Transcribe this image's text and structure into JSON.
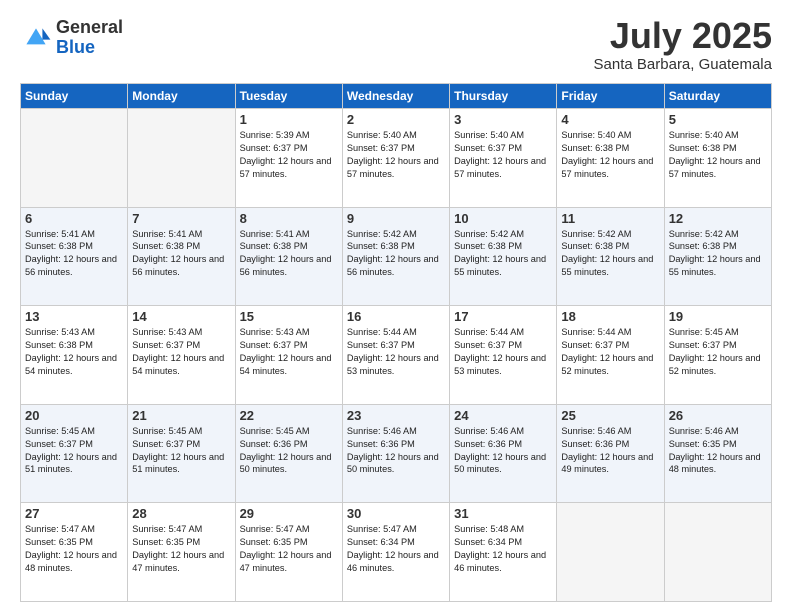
{
  "header": {
    "logo": {
      "general": "General",
      "blue": "Blue"
    },
    "title": "July 2025",
    "location": "Santa Barbara, Guatemala"
  },
  "days_of_week": [
    "Sunday",
    "Monday",
    "Tuesday",
    "Wednesday",
    "Thursday",
    "Friday",
    "Saturday"
  ],
  "weeks": [
    [
      {
        "day": "",
        "empty": true
      },
      {
        "day": "",
        "empty": true
      },
      {
        "day": "1",
        "sunrise": "Sunrise: 5:39 AM",
        "sunset": "Sunset: 6:37 PM",
        "daylight": "Daylight: 12 hours and 57 minutes."
      },
      {
        "day": "2",
        "sunrise": "Sunrise: 5:40 AM",
        "sunset": "Sunset: 6:37 PM",
        "daylight": "Daylight: 12 hours and 57 minutes."
      },
      {
        "day": "3",
        "sunrise": "Sunrise: 5:40 AM",
        "sunset": "Sunset: 6:37 PM",
        "daylight": "Daylight: 12 hours and 57 minutes."
      },
      {
        "day": "4",
        "sunrise": "Sunrise: 5:40 AM",
        "sunset": "Sunset: 6:38 PM",
        "daylight": "Daylight: 12 hours and 57 minutes."
      },
      {
        "day": "5",
        "sunrise": "Sunrise: 5:40 AM",
        "sunset": "Sunset: 6:38 PM",
        "daylight": "Daylight: 12 hours and 57 minutes."
      }
    ],
    [
      {
        "day": "6",
        "sunrise": "Sunrise: 5:41 AM",
        "sunset": "Sunset: 6:38 PM",
        "daylight": "Daylight: 12 hours and 56 minutes."
      },
      {
        "day": "7",
        "sunrise": "Sunrise: 5:41 AM",
        "sunset": "Sunset: 6:38 PM",
        "daylight": "Daylight: 12 hours and 56 minutes."
      },
      {
        "day": "8",
        "sunrise": "Sunrise: 5:41 AM",
        "sunset": "Sunset: 6:38 PM",
        "daylight": "Daylight: 12 hours and 56 minutes."
      },
      {
        "day": "9",
        "sunrise": "Sunrise: 5:42 AM",
        "sunset": "Sunset: 6:38 PM",
        "daylight": "Daylight: 12 hours and 56 minutes."
      },
      {
        "day": "10",
        "sunrise": "Sunrise: 5:42 AM",
        "sunset": "Sunset: 6:38 PM",
        "daylight": "Daylight: 12 hours and 55 minutes."
      },
      {
        "day": "11",
        "sunrise": "Sunrise: 5:42 AM",
        "sunset": "Sunset: 6:38 PM",
        "daylight": "Daylight: 12 hours and 55 minutes."
      },
      {
        "day": "12",
        "sunrise": "Sunrise: 5:42 AM",
        "sunset": "Sunset: 6:38 PM",
        "daylight": "Daylight: 12 hours and 55 minutes."
      }
    ],
    [
      {
        "day": "13",
        "sunrise": "Sunrise: 5:43 AM",
        "sunset": "Sunset: 6:38 PM",
        "daylight": "Daylight: 12 hours and 54 minutes."
      },
      {
        "day": "14",
        "sunrise": "Sunrise: 5:43 AM",
        "sunset": "Sunset: 6:37 PM",
        "daylight": "Daylight: 12 hours and 54 minutes."
      },
      {
        "day": "15",
        "sunrise": "Sunrise: 5:43 AM",
        "sunset": "Sunset: 6:37 PM",
        "daylight": "Daylight: 12 hours and 54 minutes."
      },
      {
        "day": "16",
        "sunrise": "Sunrise: 5:44 AM",
        "sunset": "Sunset: 6:37 PM",
        "daylight": "Daylight: 12 hours and 53 minutes."
      },
      {
        "day": "17",
        "sunrise": "Sunrise: 5:44 AM",
        "sunset": "Sunset: 6:37 PM",
        "daylight": "Daylight: 12 hours and 53 minutes."
      },
      {
        "day": "18",
        "sunrise": "Sunrise: 5:44 AM",
        "sunset": "Sunset: 6:37 PM",
        "daylight": "Daylight: 12 hours and 52 minutes."
      },
      {
        "day": "19",
        "sunrise": "Sunrise: 5:45 AM",
        "sunset": "Sunset: 6:37 PM",
        "daylight": "Daylight: 12 hours and 52 minutes."
      }
    ],
    [
      {
        "day": "20",
        "sunrise": "Sunrise: 5:45 AM",
        "sunset": "Sunset: 6:37 PM",
        "daylight": "Daylight: 12 hours and 51 minutes."
      },
      {
        "day": "21",
        "sunrise": "Sunrise: 5:45 AM",
        "sunset": "Sunset: 6:37 PM",
        "daylight": "Daylight: 12 hours and 51 minutes."
      },
      {
        "day": "22",
        "sunrise": "Sunrise: 5:45 AM",
        "sunset": "Sunset: 6:36 PM",
        "daylight": "Daylight: 12 hours and 50 minutes."
      },
      {
        "day": "23",
        "sunrise": "Sunrise: 5:46 AM",
        "sunset": "Sunset: 6:36 PM",
        "daylight": "Daylight: 12 hours and 50 minutes."
      },
      {
        "day": "24",
        "sunrise": "Sunrise: 5:46 AM",
        "sunset": "Sunset: 6:36 PM",
        "daylight": "Daylight: 12 hours and 50 minutes."
      },
      {
        "day": "25",
        "sunrise": "Sunrise: 5:46 AM",
        "sunset": "Sunset: 6:36 PM",
        "daylight": "Daylight: 12 hours and 49 minutes."
      },
      {
        "day": "26",
        "sunrise": "Sunrise: 5:46 AM",
        "sunset": "Sunset: 6:35 PM",
        "daylight": "Daylight: 12 hours and 48 minutes."
      }
    ],
    [
      {
        "day": "27",
        "sunrise": "Sunrise: 5:47 AM",
        "sunset": "Sunset: 6:35 PM",
        "daylight": "Daylight: 12 hours and 48 minutes."
      },
      {
        "day": "28",
        "sunrise": "Sunrise: 5:47 AM",
        "sunset": "Sunset: 6:35 PM",
        "daylight": "Daylight: 12 hours and 47 minutes."
      },
      {
        "day": "29",
        "sunrise": "Sunrise: 5:47 AM",
        "sunset": "Sunset: 6:35 PM",
        "daylight": "Daylight: 12 hours and 47 minutes."
      },
      {
        "day": "30",
        "sunrise": "Sunrise: 5:47 AM",
        "sunset": "Sunset: 6:34 PM",
        "daylight": "Daylight: 12 hours and 46 minutes."
      },
      {
        "day": "31",
        "sunrise": "Sunrise: 5:48 AM",
        "sunset": "Sunset: 6:34 PM",
        "daylight": "Daylight: 12 hours and 46 minutes."
      },
      {
        "day": "",
        "empty": true
      },
      {
        "day": "",
        "empty": true
      }
    ]
  ]
}
